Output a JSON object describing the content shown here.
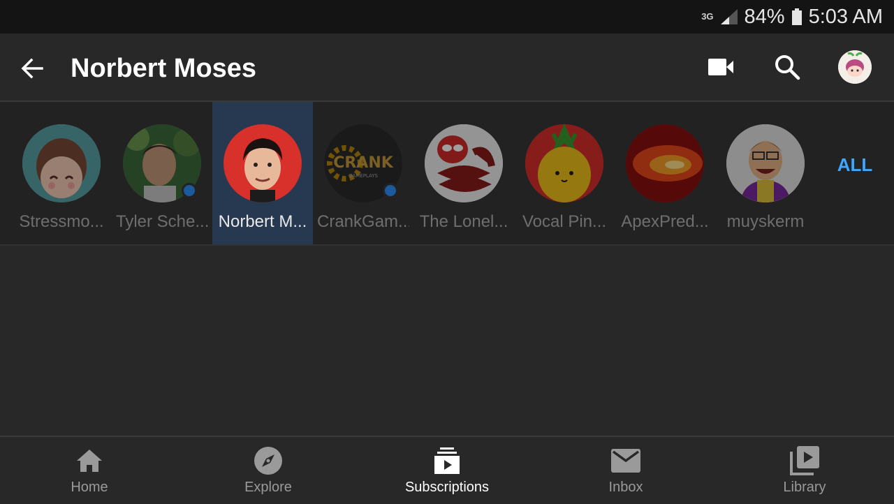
{
  "status_bar": {
    "network": "3G",
    "battery": "84%",
    "time": "5:03 AM"
  },
  "header": {
    "title": "Norbert Moses",
    "icons": [
      "back-arrow-icon",
      "video-camera-icon",
      "search-icon",
      "account-avatar"
    ]
  },
  "channels": {
    "items": [
      {
        "label": "Stressmo...",
        "selected": false,
        "new_content": false
      },
      {
        "label": "Tyler Sche...",
        "selected": false,
        "new_content": true
      },
      {
        "label": "Norbert M...",
        "selected": true,
        "new_content": false
      },
      {
        "label": "CrankGam...",
        "selected": false,
        "new_content": true
      },
      {
        "label": "The Lonel...",
        "selected": false,
        "new_content": false
      },
      {
        "label": "Vocal Pin...",
        "selected": false,
        "new_content": false
      },
      {
        "label": "ApexPred...",
        "selected": false,
        "new_content": false
      },
      {
        "label": "muyskerm",
        "selected": false,
        "new_content": false
      }
    ],
    "all_label": "ALL",
    "avatar_texts": {
      "crank_main": "CRANK",
      "crank_sub": "GAMEPLAYS"
    }
  },
  "bottom_nav": {
    "items": [
      {
        "label": "Home",
        "icon": "home-icon",
        "active": false
      },
      {
        "label": "Explore",
        "icon": "explore-compass-icon",
        "active": false
      },
      {
        "label": "Subscriptions",
        "icon": "subscriptions-icon",
        "active": true
      },
      {
        "label": "Inbox",
        "icon": "inbox-mail-icon",
        "active": false
      },
      {
        "label": "Library",
        "icon": "library-icon",
        "active": false
      }
    ]
  },
  "colors": {
    "accent": "#3ea6ff",
    "selected_channel_bg": "#263951",
    "background": "#282828",
    "status_bar": "#141414"
  }
}
